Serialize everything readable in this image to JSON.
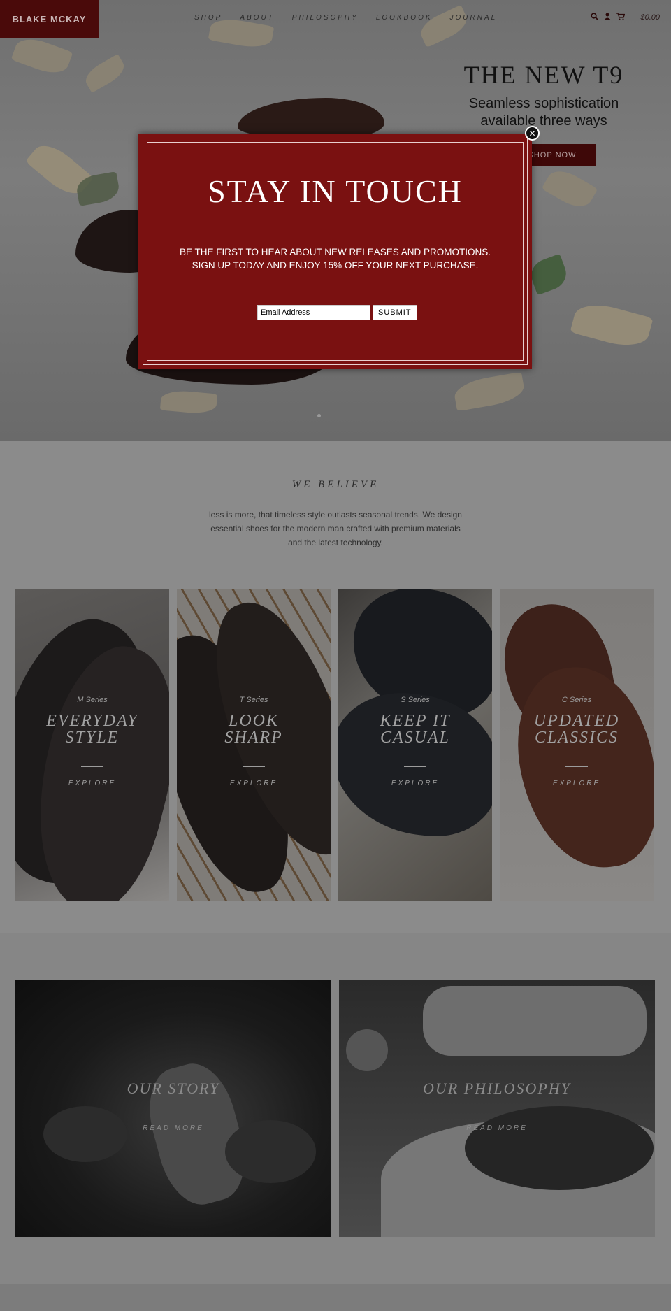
{
  "header": {
    "logo": "BLAKE MCKAY",
    "nav": [
      "SHOP",
      "ABOUT",
      "PHILOSOPHY",
      "LOOKBOOK",
      "JOURNAL"
    ],
    "icons": [
      "search-icon",
      "user-icon",
      "cart-icon"
    ],
    "cart_total": "$0.00"
  },
  "hero": {
    "title": "THE NEW T9",
    "subtitle_line1": "Seamless sophistication",
    "subtitle_line2": "available three ways",
    "button": "SHOP NOW"
  },
  "believe": {
    "title": "WE BELIEVE",
    "text": "less is more, that timeless style outlasts seasonal trends. We design essential shoes for the modern man crafted with premium materials and the latest technology."
  },
  "tiles": [
    {
      "series": "M Series",
      "title": "EVERYDAY STYLE",
      "cta": "EXPLORE"
    },
    {
      "series": "T Series",
      "title": "LOOK SHARP",
      "cta": "EXPLORE"
    },
    {
      "series": "S Series",
      "title": "KEEP IT CASUAL",
      "cta": "EXPLORE"
    },
    {
      "series": "C Series",
      "title": "UPDATED CLASSICS",
      "cta": "EXPLORE"
    }
  ],
  "panels": [
    {
      "title": "OUR STORY",
      "cta": "READ MORE"
    },
    {
      "title": "OUR PHILOSOPHY",
      "cta": "READ MORE"
    }
  ],
  "modal": {
    "title": "STAY IN TOUCH",
    "line1": "BE THE FIRST TO HEAR ABOUT NEW RELEASES AND PROMOTIONS.",
    "line2": "SIGN UP TODAY AND ENJOY 15% OFF YOUR NEXT PURCHASE.",
    "email_placeholder": "Email Address",
    "submit": "SUBMIT",
    "close_icon": "close-icon"
  },
  "colors": {
    "brand": "#4a0a0a",
    "modal_bg": "#7a1111"
  }
}
